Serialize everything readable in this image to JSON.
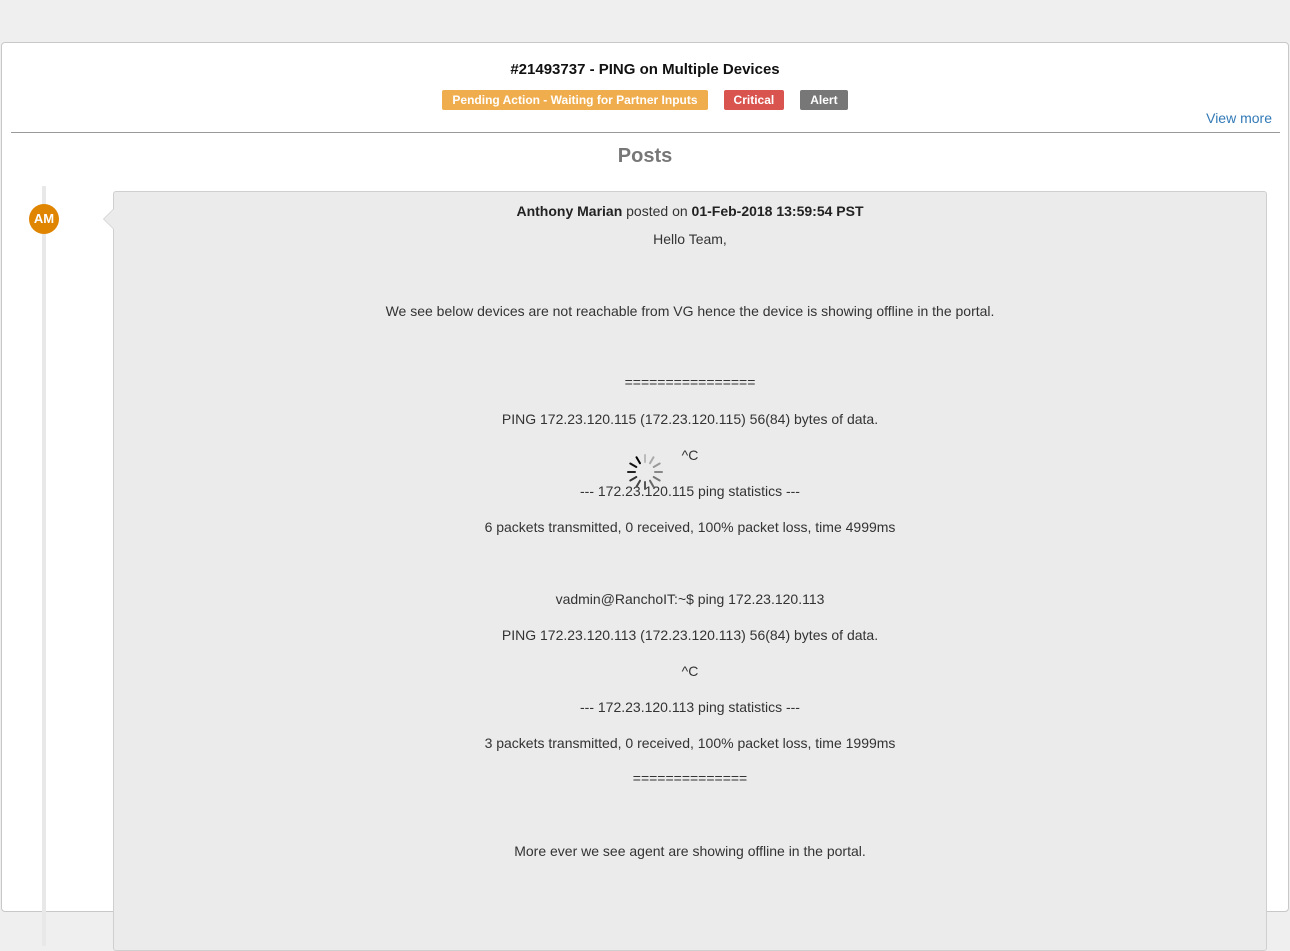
{
  "ticket": {
    "title": "#21493737 - PING on Multiple Devices",
    "badges": {
      "status": "Pending Action - Waiting for Partner Inputs",
      "priority": "Critical",
      "type": "Alert"
    },
    "view_more": "View more"
  },
  "posts_heading": "Posts",
  "post": {
    "avatar_initials": "AM",
    "author": "Anthony Marian",
    "posted_on_label": " posted on ",
    "timestamp": "01-Feb-2018 13:59:54 PST",
    "lines": [
      "Hello Team,",
      "We see below devices are not reachable from VG hence the device is showing offline in the portal.",
      "================",
      "PING 172.23.120.115 (172.23.120.115) 56(84) bytes of data.",
      "^C",
      "--- 172.23.120.115 ping statistics ---",
      "6 packets transmitted, 0 received, 100% packet loss, time 4999ms",
      "vadmin@RanchoIT:~$ ping 172.23.120.113",
      "PING 172.23.120.113 (172.23.120.113) 56(84) bytes of data.",
      "^C",
      "--- 172.23.120.113 ping statistics ---",
      "3 packets transmitted, 0 received, 100% packet loss, time 1999ms",
      "==============",
      "More ever we see agent are showing offline in the portal."
    ]
  },
  "colors": {
    "pending": "#f0ad4e",
    "critical": "#d9534f",
    "alert": "#777777",
    "avatar": "#e08500",
    "link": "#337ab7"
  }
}
